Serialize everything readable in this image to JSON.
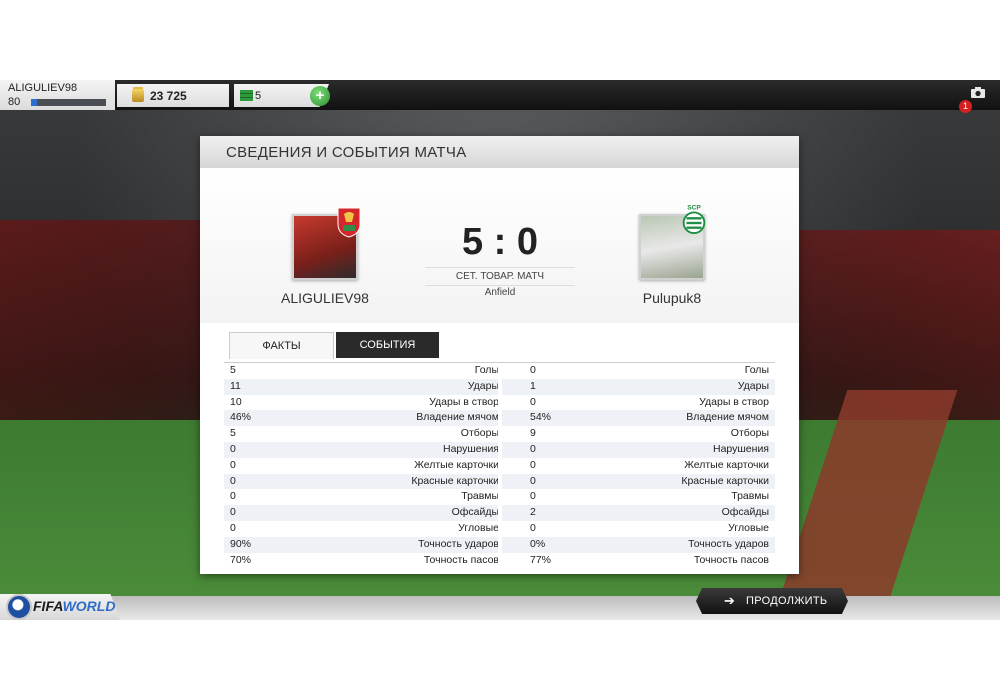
{
  "topbar": {
    "player_name": "ALIGULIEV98",
    "level": "80",
    "xp_progress": 0.08,
    "coins": "23 725",
    "points": "5",
    "plus_label": "+",
    "notification_count": "1"
  },
  "panel": {
    "title": "СВЕДЕНИЯ И СОБЫТИЯ МАТЧА",
    "home_team": "ALIGULIEV98",
    "away_team": "Pulupuk8",
    "score": "5 : 0",
    "match_type": "СЕТ. ТОВАР. МАТЧ",
    "stadium": "Anfield",
    "tabs": {
      "facts": "ФАКТЫ",
      "events": "СОБЫТИЯ"
    }
  },
  "stats": [
    {
      "label": "Голы",
      "home": "5",
      "away": "0"
    },
    {
      "label": "Удары",
      "home": "11",
      "away": "1"
    },
    {
      "label": "Удары в створ",
      "home": "10",
      "away": "0"
    },
    {
      "label": "Владение мячом",
      "home": "46%",
      "away": "54%"
    },
    {
      "label": "Отборы",
      "home": "5",
      "away": "9"
    },
    {
      "label": "Нарушения",
      "home": "0",
      "away": "0"
    },
    {
      "label": "Желтые карточки",
      "home": "0",
      "away": "0"
    },
    {
      "label": "Красные карточки",
      "home": "0",
      "away": "0"
    },
    {
      "label": "Травмы",
      "home": "0",
      "away": "0"
    },
    {
      "label": "Офсайды",
      "home": "0",
      "away": "2"
    },
    {
      "label": "Угловые",
      "home": "0",
      "away": "0"
    },
    {
      "label": "Точность ударов",
      "home": "90%",
      "away": "0%"
    },
    {
      "label": "Точность пасов",
      "home": "70%",
      "away": "77%"
    }
  ],
  "footer": {
    "logo_prefix": "FIFA",
    "logo_suffix": "WORLD",
    "continue_label": "ПРОДОЛЖИТЬ"
  },
  "icons": {
    "coin": "coin-stack-icon",
    "points": "fifa-points-icon",
    "camera": "camera-icon",
    "continue": "arrow-right-icon"
  },
  "colors": {
    "accent_blue": "#2d6fd0",
    "plus_green": "#2f8e2f",
    "badge_red": "#d62020"
  }
}
